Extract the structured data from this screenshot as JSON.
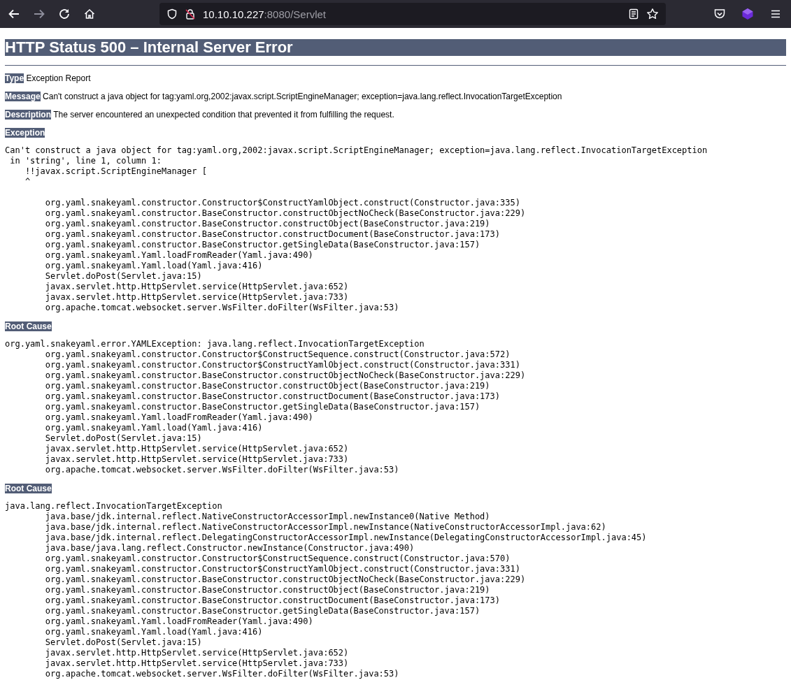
{
  "browser": {
    "url_host": "10.10.10.227",
    "url_rest": ":8080/Servlet",
    "forward_disabled": true
  },
  "page": {
    "title": "HTTP Status 500 – Internal Server Error",
    "details": [
      {
        "label": "Type",
        "text": "Exception Report"
      },
      {
        "label": "Message",
        "text": "Can't construct a java object for tag:yaml.org,2002:javax.script.ScriptEngineManager; exception=java.lang.reflect.InvocationTargetException"
      },
      {
        "label": "Description",
        "text": "The server encountered an unexpected condition that prevented it from fulfilling the request."
      }
    ],
    "sections": [
      {
        "label": "Exception",
        "trace": [
          "Can't construct a java object for tag:yaml.org,2002:javax.script.ScriptEngineManager; exception=java.lang.reflect.InvocationTargetException",
          " in 'string', line 1, column 1:",
          "    !!javax.script.ScriptEngineManager [",
          "    ^"
        ],
        "gap": true,
        "frames": [
          "\torg.yaml.snakeyaml.constructor.Constructor$ConstructYamlObject.construct(Constructor.java:335)",
          "\torg.yaml.snakeyaml.constructor.BaseConstructor.constructObjectNoCheck(BaseConstructor.java:229)",
          "\torg.yaml.snakeyaml.constructor.BaseConstructor.constructObject(BaseConstructor.java:219)",
          "\torg.yaml.snakeyaml.constructor.BaseConstructor.constructDocument(BaseConstructor.java:173)",
          "\torg.yaml.snakeyaml.constructor.BaseConstructor.getSingleData(BaseConstructor.java:157)",
          "\torg.yaml.snakeyaml.Yaml.loadFromReader(Yaml.java:490)",
          "\torg.yaml.snakeyaml.Yaml.load(Yaml.java:416)",
          "\tServlet.doPost(Servlet.java:15)",
          "\tjavax.servlet.http.HttpServlet.service(HttpServlet.java:652)",
          "\tjavax.servlet.http.HttpServlet.service(HttpServlet.java:733)",
          "\torg.apache.tomcat.websocket.server.WsFilter.doFilter(WsFilter.java:53)"
        ]
      },
      {
        "label": "Root Cause",
        "gap": false,
        "trace": [
          "org.yaml.snakeyaml.error.YAMLException: java.lang.reflect.InvocationTargetException"
        ],
        "frames": [
          "\torg.yaml.snakeyaml.constructor.Constructor$ConstructSequence.construct(Constructor.java:572)",
          "\torg.yaml.snakeyaml.constructor.Constructor$ConstructYamlObject.construct(Constructor.java:331)",
          "\torg.yaml.snakeyaml.constructor.BaseConstructor.constructObjectNoCheck(BaseConstructor.java:229)",
          "\torg.yaml.snakeyaml.constructor.BaseConstructor.constructObject(BaseConstructor.java:219)",
          "\torg.yaml.snakeyaml.constructor.BaseConstructor.constructDocument(BaseConstructor.java:173)",
          "\torg.yaml.snakeyaml.constructor.BaseConstructor.getSingleData(BaseConstructor.java:157)",
          "\torg.yaml.snakeyaml.Yaml.loadFromReader(Yaml.java:490)",
          "\torg.yaml.snakeyaml.Yaml.load(Yaml.java:416)",
          "\tServlet.doPost(Servlet.java:15)",
          "\tjavax.servlet.http.HttpServlet.service(HttpServlet.java:652)",
          "\tjavax.servlet.http.HttpServlet.service(HttpServlet.java:733)",
          "\torg.apache.tomcat.websocket.server.WsFilter.doFilter(WsFilter.java:53)"
        ]
      },
      {
        "label": "Root Cause",
        "gap": false,
        "trace": [
          "java.lang.reflect.InvocationTargetException"
        ],
        "frames": [
          "\tjava.base/jdk.internal.reflect.NativeConstructorAccessorImpl.newInstance0(Native Method)",
          "\tjava.base/jdk.internal.reflect.NativeConstructorAccessorImpl.newInstance(NativeConstructorAccessorImpl.java:62)",
          "\tjava.base/jdk.internal.reflect.DelegatingConstructorAccessorImpl.newInstance(DelegatingConstructorAccessorImpl.java:45)",
          "\tjava.base/java.lang.reflect.Constructor.newInstance(Constructor.java:490)",
          "\torg.yaml.snakeyaml.constructor.Constructor$ConstructSequence.construct(Constructor.java:570)",
          "\torg.yaml.snakeyaml.constructor.Constructor$ConstructYamlObject.construct(Constructor.java:331)",
          "\torg.yaml.snakeyaml.constructor.BaseConstructor.constructObjectNoCheck(BaseConstructor.java:229)",
          "\torg.yaml.snakeyaml.constructor.BaseConstructor.constructObject(BaseConstructor.java:219)",
          "\torg.yaml.snakeyaml.constructor.BaseConstructor.constructDocument(BaseConstructor.java:173)",
          "\torg.yaml.snakeyaml.constructor.BaseConstructor.getSingleData(BaseConstructor.java:157)",
          "\torg.yaml.snakeyaml.Yaml.loadFromReader(Yaml.java:490)",
          "\torg.yaml.snakeyaml.Yaml.load(Yaml.java:416)",
          "\tServlet.doPost(Servlet.java:15)",
          "\tjavax.servlet.http.HttpServlet.service(HttpServlet.java:652)",
          "\tjavax.servlet.http.HttpServlet.service(HttpServlet.java:733)",
          "\torg.apache.tomcat.websocket.server.WsFilter.doFilter(WsFilter.java:53)"
        ]
      }
    ]
  }
}
